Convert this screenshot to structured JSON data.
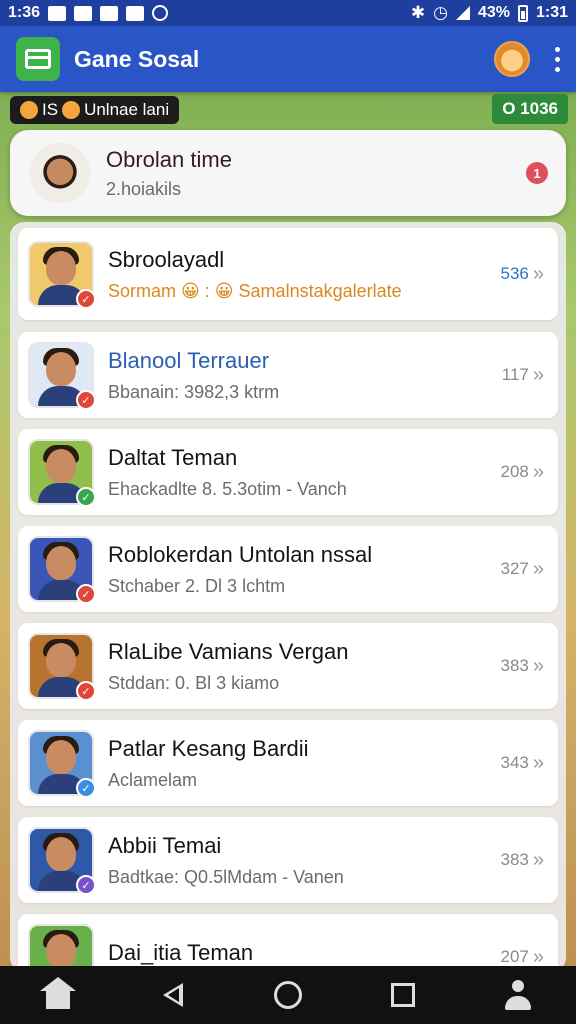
{
  "status_bar": {
    "time_left": "1:36",
    "battery": "43%",
    "time_right": "1:31"
  },
  "app_bar": {
    "title": "Gane Sosal"
  },
  "banner": {
    "online_label": "Unlnae lani",
    "online_prefix": "IS",
    "count": "O 1036"
  },
  "top_card": {
    "title": "Obrolan time",
    "subtitle": "2.hoiakils",
    "notification_count": "1"
  },
  "list": {
    "items": [
      {
        "name": "Sbroolayadl",
        "detail": "Sormam 😀 : 😀 Samalnstakgalerlate",
        "meta": "536",
        "badge_color": "#e0463a",
        "name_color": "#151515",
        "detail_color": "#d7891c",
        "meta_color": "#2f72c9",
        "thumb_bg": "#f0c96a"
      },
      {
        "name": "Blanool Terrauer",
        "detail": "Bbanain: 3982,3 ktrm",
        "meta": "117",
        "badge_color": "#e0463a",
        "name_color": "#2d5fb0",
        "detail_color": "#6c6c6c",
        "meta_color": "#8a8a8a",
        "thumb_bg": "#dfe8f5"
      },
      {
        "name": "Daltat Teman",
        "detail": "Ehackadlte  8. 5.3otim - Vanch",
        "meta": "208",
        "badge_color": "#3aa550",
        "name_color": "#151515",
        "detail_color": "#6c6c6c",
        "meta_color": "#8a8a8a",
        "thumb_bg": "#8fbf4a"
      },
      {
        "name": "Roblokerdan Untolan nssal",
        "detail": "Stchaber 2. Dl 3 lchtm",
        "meta": "327",
        "badge_color": "#e0463a",
        "name_color": "#151515",
        "detail_color": "#6c6c6c",
        "meta_color": "#8a8a8a",
        "thumb_bg": "#3a56b8"
      },
      {
        "name": "RlaLibe Vamians Vergan",
        "detail": "Stddan: 0. Bl 3 kiamo",
        "meta": "383",
        "badge_color": "#e0463a",
        "name_color": "#151515",
        "detail_color": "#6c6c6c",
        "meta_color": "#8a8a8a",
        "thumb_bg": "#b8742e"
      },
      {
        "name": "Patlar Kesang Bardii",
        "detail": "Aclamelam",
        "meta": "343",
        "badge_color": "#3a8fe0",
        "name_color": "#151515",
        "detail_color": "#6c6c6c",
        "meta_color": "#8a8a8a",
        "thumb_bg": "#5a8fd0"
      },
      {
        "name": "Abbii Temai",
        "detail": "Badtkae: Q0.5lMdam - Vanen",
        "meta": "383",
        "badge_color": "#7a52c9",
        "name_color": "#151515",
        "detail_color": "#6c6c6c",
        "meta_color": "#8a8a8a",
        "thumb_bg": "#2f58a8"
      },
      {
        "name": "Dai_itia Teman",
        "detail": "",
        "meta": "207",
        "badge_color": "#e0463a",
        "name_color": "#151515",
        "detail_color": "#6c6c6c",
        "meta_color": "#8a8a8a",
        "thumb_bg": "#6ab04a"
      }
    ]
  },
  "colors": {
    "status_bar": "#1f3f9e",
    "app_bar": "#2a55c6",
    "logo": "#3db34a"
  }
}
